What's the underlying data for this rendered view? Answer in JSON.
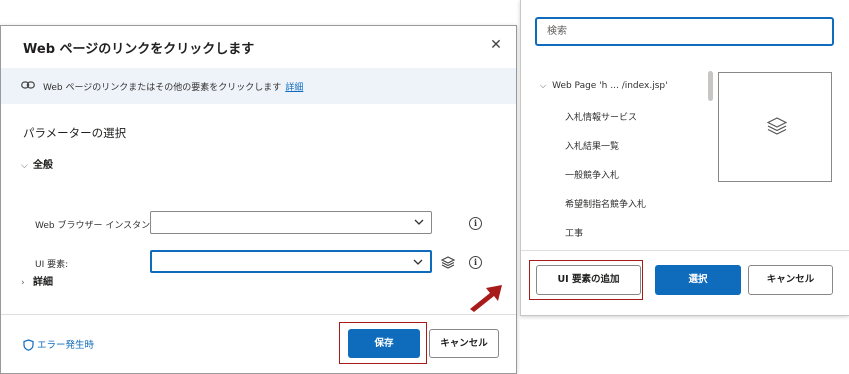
{
  "dialog": {
    "title": "Web ページのリンクをクリックします",
    "info_text": "Web ページのリンクまたはその他の要素をクリックします",
    "info_link": "詳細",
    "section_title": "パラメーターの選択",
    "general_group": "全般",
    "browser_label": "Web ブラウザー インスタンス:",
    "ui_element_label": "UI 要素:",
    "advanced_group": "詳細",
    "error_link": "エラー発生時",
    "save_label": "保存",
    "cancel_label": "キャンセル"
  },
  "picker": {
    "search_placeholder": "検索",
    "tree_root": "Web Page 'h ... /index.jsp'",
    "tree_items": [
      "入札情報サービス",
      "入札結果一覧",
      "一般競争入札",
      "希望制指名競争入札",
      "工事"
    ],
    "add_ui_element_label": "UI 要素の追加",
    "select_label": "選択",
    "cancel_label": "キャンセル"
  },
  "colors": {
    "primary": "#0f6cbd",
    "highlight": "#a81b1b",
    "arrow": "#a81b1b",
    "info_bg": "#eef3fa"
  }
}
